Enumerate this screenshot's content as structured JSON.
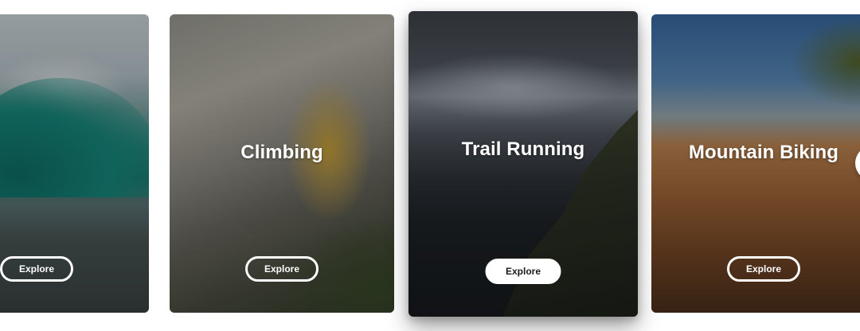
{
  "cards": [
    {
      "title": "",
      "cta": "Explore",
      "image": "surfing-wave-photo"
    },
    {
      "title": "Climbing",
      "cta": "Explore",
      "image": "rock-climber-photo"
    },
    {
      "title": "Trail Running",
      "cta": "Explore",
      "image": "trail-runners-mountain-photo"
    },
    {
      "title": "Mountain Biking",
      "cta": "Explore",
      "image": "mountain-bikers-photo"
    }
  ],
  "colors": {
    "cta_text_active": "#1a1a1a",
    "cta_border": "#ffffff",
    "title_text": "#ffffff"
  },
  "icons": {
    "next": "chevron-right-icon"
  }
}
